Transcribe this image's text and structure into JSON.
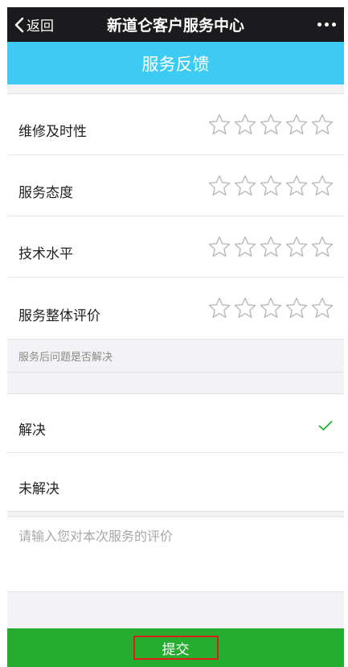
{
  "nav": {
    "back_label": "返回",
    "title": "新道仑客户服务中心"
  },
  "header": {
    "title": "服务反馈"
  },
  "ratings": [
    {
      "label": "维修及时性",
      "stars": 0,
      "max": 5
    },
    {
      "label": "服务态度",
      "stars": 0,
      "max": 5
    },
    {
      "label": "技术水平",
      "stars": 0,
      "max": 5
    },
    {
      "label": "服务整体评价",
      "stars": 0,
      "max": 5
    }
  ],
  "resolution": {
    "section_label": "服务后问题是否解决",
    "options": [
      {
        "label": "解决",
        "selected": true
      },
      {
        "label": "未解决",
        "selected": false
      }
    ]
  },
  "comment": {
    "placeholder": "请输入您对本次服务的评价",
    "value": ""
  },
  "submit": {
    "label": "提交"
  },
  "colors": {
    "nav_bg": "#1b1b1d",
    "header_bg": "#3dcbf3",
    "submit_bg": "#26ad2f",
    "check": "#26ad2f",
    "highlight_border": "#e01b1b"
  },
  "icons": {
    "back": "chevron-left-icon",
    "more": "more-dots-icon",
    "star": "star-outline-icon",
    "check": "checkmark-icon"
  }
}
